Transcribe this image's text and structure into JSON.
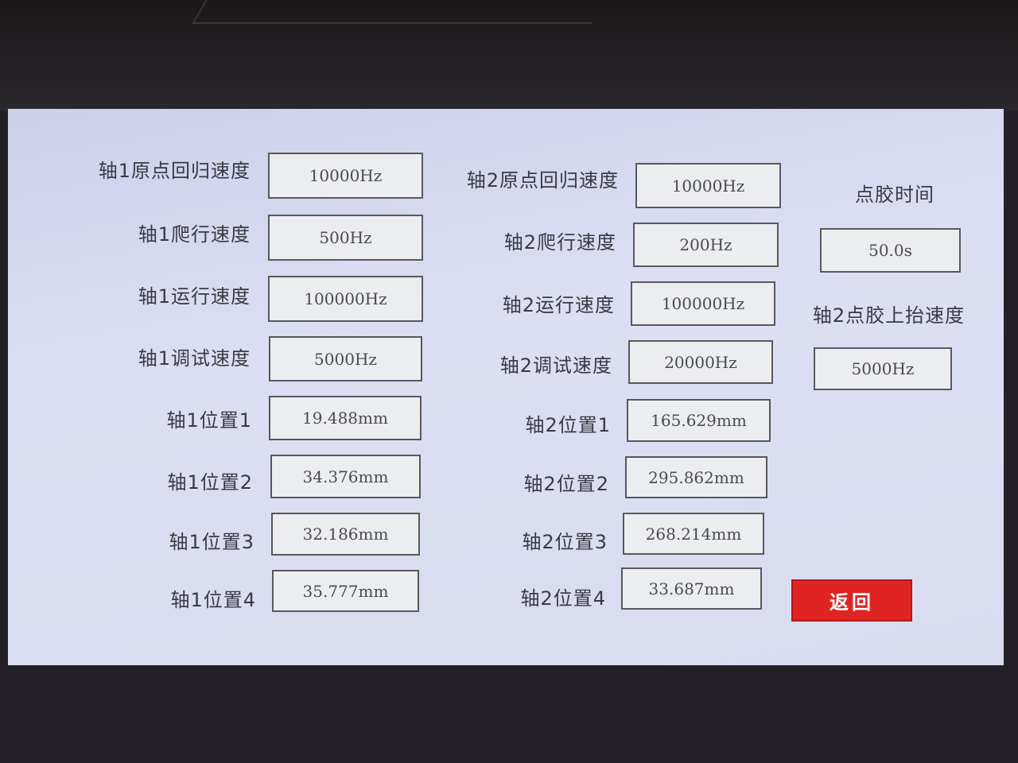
{
  "axis1": {
    "home_speed": {
      "label": "轴1原点回归速度",
      "value": "10000Hz"
    },
    "crawl_speed": {
      "label": "轴1爬行速度",
      "value": "500Hz"
    },
    "run_speed": {
      "label": "轴1运行速度",
      "value": "100000Hz"
    },
    "debug_speed": {
      "label": "轴1调试速度",
      "value": "5000Hz"
    },
    "pos1": {
      "label": "轴1位置1",
      "value": "19.488mm"
    },
    "pos2": {
      "label": "轴1位置2",
      "value": "34.376mm"
    },
    "pos3": {
      "label": "轴1位置3",
      "value": "32.186mm"
    },
    "pos4": {
      "label": "轴1位置4",
      "value": "35.777mm"
    }
  },
  "axis2": {
    "home_speed": {
      "label": "轴2原点回归速度",
      "value": "10000Hz"
    },
    "crawl_speed": {
      "label": "轴2爬行速度",
      "value": "200Hz"
    },
    "run_speed": {
      "label": "轴2运行速度",
      "value": "100000Hz"
    },
    "debug_speed": {
      "label": "轴2调试速度",
      "value": "20000Hz"
    },
    "pos1": {
      "label": "轴2位置1",
      "value": "165.629mm"
    },
    "pos2": {
      "label": "轴2位置2",
      "value": "295.862mm"
    },
    "pos3": {
      "label": "轴2位置3",
      "value": "268.214mm"
    },
    "pos4": {
      "label": "轴2位置4",
      "value": "33.687mm"
    }
  },
  "dispense": {
    "time": {
      "label": "点胶时间",
      "value": "50.0s"
    },
    "lift_speed": {
      "label": "轴2点胶上抬速度",
      "value": "5000Hz"
    }
  },
  "buttons": {
    "back": "返回"
  },
  "colors": {
    "screen_bg": "#d9dcef",
    "back_button": "#e02424"
  }
}
